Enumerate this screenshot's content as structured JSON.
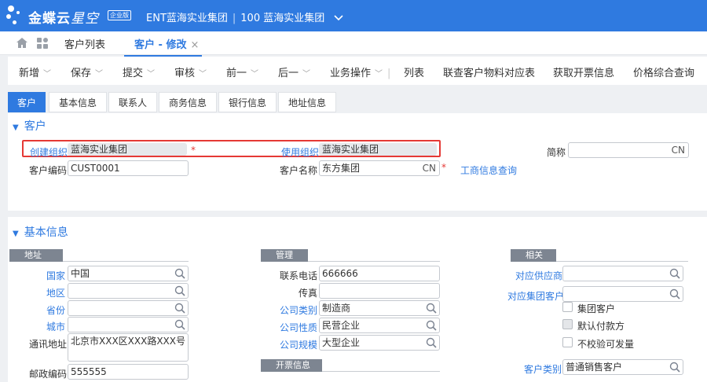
{
  "app": {
    "name_main": "金蝶云",
    "name_sub": "星空",
    "edition": "企业版",
    "tenant": "ENT蓝海实业集团",
    "org": "100 蓝海实业集团"
  },
  "tabs": [
    {
      "label": "客户列表"
    },
    {
      "label": "客户 - 修改",
      "close": "×"
    }
  ],
  "toolbar": [
    "新增",
    "保存",
    "提交",
    "审核",
    "前一",
    "后一",
    "业务操作",
    "列表",
    "联查客户物料对应表",
    "获取开票信息",
    "价格综合查询"
  ],
  "subtabs": [
    "客户",
    "基本信息",
    "联系人",
    "商务信息",
    "银行信息",
    "地址信息"
  ],
  "customer": {
    "title": "客户",
    "create_org_label": "创建组织",
    "create_org": "蓝海实业集团",
    "required_mark": "*",
    "use_org_label": "使用组织",
    "use_org": "蓝海实业集团",
    "short_name_label": "简称",
    "short_name_lang": "CN",
    "code_label": "客户编码",
    "code": "CUST0001",
    "name_label": "客户名称",
    "name": "东方集团",
    "name_lang": "CN",
    "biz_query": "工商信息查询"
  },
  "basic": {
    "title": "基本信息",
    "address_group": "地址",
    "country_label": "国家",
    "country": "中国",
    "region_label": "地区",
    "province_label": "省份",
    "city_label": "城市",
    "address_label": "通讯地址",
    "address": "北京市XXX区XXX路XXX号",
    "postcode_label": "邮政编码",
    "postcode": "555555",
    "manage_group": "管理",
    "phone_label": "联系电话",
    "phone": "666666",
    "fax_label": "传真",
    "company_type_label": "公司类别",
    "company_type": "制造商",
    "company_nature_label": "公司性质",
    "company_nature": "民营企业",
    "company_scale_label": "公司规模",
    "company_scale": "大型企业",
    "invoice_group": "开票信息",
    "related_group": "相关",
    "supplier_label": "对应供应商",
    "group_customer_label": "对应集团客户",
    "chk_group_customer": "集团客户",
    "chk_default_payer": "默认付款方",
    "chk_no_verify": "不校验可发量",
    "customer_type_label": "客户类别",
    "customer_type": "普通销售客户"
  }
}
